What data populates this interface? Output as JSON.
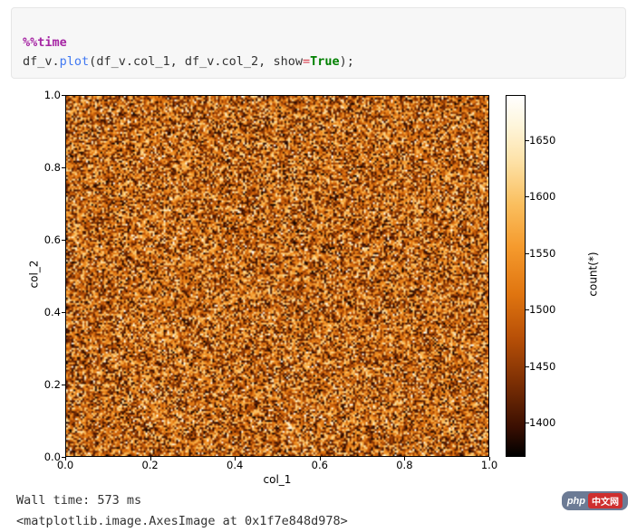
{
  "code": {
    "magic": "%%time",
    "obj": "df_v",
    "method": "plot",
    "arg1_obj": "df_v",
    "arg1_attr": "col_1",
    "arg2_obj": "df_v",
    "arg2_attr": "col_2",
    "kwarg_name": "show",
    "kwarg_value": "True",
    "terminator": ";"
  },
  "chart_data": {
    "type": "heatmap",
    "title": "",
    "xlabel": "col_1",
    "ylabel": "col_2",
    "xlim": [
      0.0,
      1.0
    ],
    "ylim": [
      0.0,
      1.0
    ],
    "x_ticks": [
      0.0,
      0.2,
      0.4,
      0.6,
      0.8,
      1.0
    ],
    "y_ticks": [
      0.0,
      0.2,
      0.4,
      0.6,
      0.8,
      1.0
    ],
    "colorbar": {
      "label": "count(*)",
      "min": 1370,
      "max": 1690,
      "ticks": [
        1400,
        1450,
        1500,
        1550,
        1600,
        1650
      ],
      "colormap": "afmhot-like (black→dark-red→orange→light-yellow→white)"
    },
    "note": "Dense 2D histogram of ~uniform random (col_1, col_2); per-bin counts visually cluster around ~1500 with noise; individual cell values not readable at this resolution."
  },
  "output": {
    "wall_time": "Wall time: 573 ms",
    "repr": "<matplotlib.image.AxesImage at 0x1f7e848d978>"
  },
  "watermark": {
    "brand": "php",
    "suffix": "中文网"
  }
}
